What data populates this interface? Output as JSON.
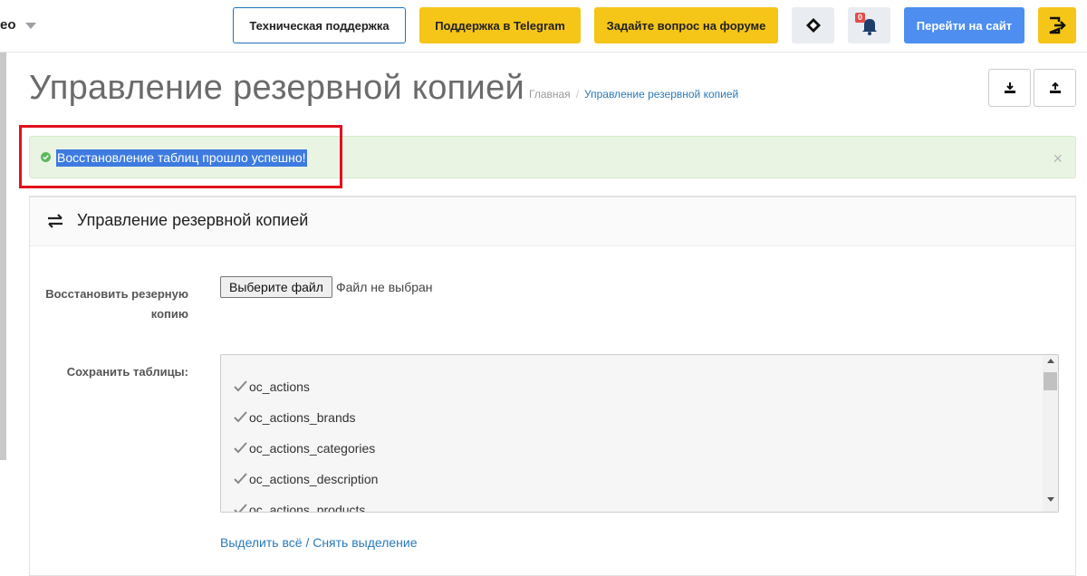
{
  "header": {
    "brand": "eo",
    "support_label": "Техническая поддержка",
    "telegram_label": "Поддержка в Telegram",
    "forum_label": "Задайте вопрос на форуме",
    "notifications_count": "0",
    "go_site_label": "Перейти на сайт"
  },
  "page": {
    "title": "Управление резервной копией",
    "breadcrumb": {
      "home": "Главная",
      "separator": "/",
      "current": "Управление резервной копией"
    }
  },
  "alert": {
    "message": "Восстановление таблиц прошло успешно!",
    "close": "×"
  },
  "panel": {
    "title": "Управление резервной копией",
    "restore_label": "Восстановить резерную копию",
    "file_button": "Выберите файл",
    "file_status": "Файл не выбран",
    "tables_label": "Сохранить таблицы:",
    "tables": [
      {
        "name": "oc_actions",
        "checked": true
      },
      {
        "name": "oc_actions_brands",
        "checked": true
      },
      {
        "name": "oc_actions_categories",
        "checked": true
      },
      {
        "name": "oc_actions_description",
        "checked": true
      },
      {
        "name": "oc_actions_products",
        "checked": true
      }
    ],
    "select_all": "Выделить всё",
    "links_separator": "/",
    "deselect": "Снять выделение"
  },
  "colors": {
    "accent_yellow": "#f5c518",
    "accent_blue": "#4d8ef0",
    "success_bg": "#e9f4e3",
    "highlight_red": "#e3101e",
    "link": "#2a7ab8"
  }
}
